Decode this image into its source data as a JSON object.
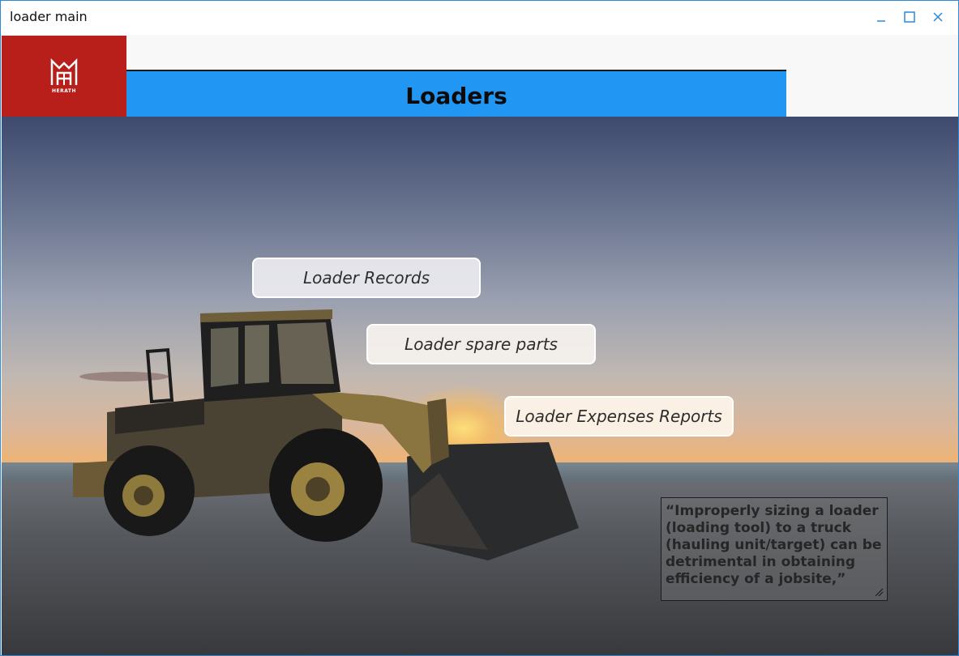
{
  "window": {
    "title": "loader main",
    "controls": {
      "minimize_icon": "minimize-icon",
      "maximize_icon": "maximize-icon",
      "close_icon": "close-icon"
    }
  },
  "header": {
    "logo_text": "HERATH",
    "page_title": "Loaders",
    "colors": {
      "logo_bg": "#b81e1a",
      "title_bar": "#2196f3"
    }
  },
  "menu": {
    "records_label": "Loader Records",
    "spare_parts_label": "Loader spare parts",
    "expenses_label": "Loader Expenses Reports"
  },
  "quote": {
    "text": "“Improperly sizing a loader (loading tool) to a truck (hauling unit/target) can be detrimental in obtaining efficiency of a jobsite,”"
  }
}
